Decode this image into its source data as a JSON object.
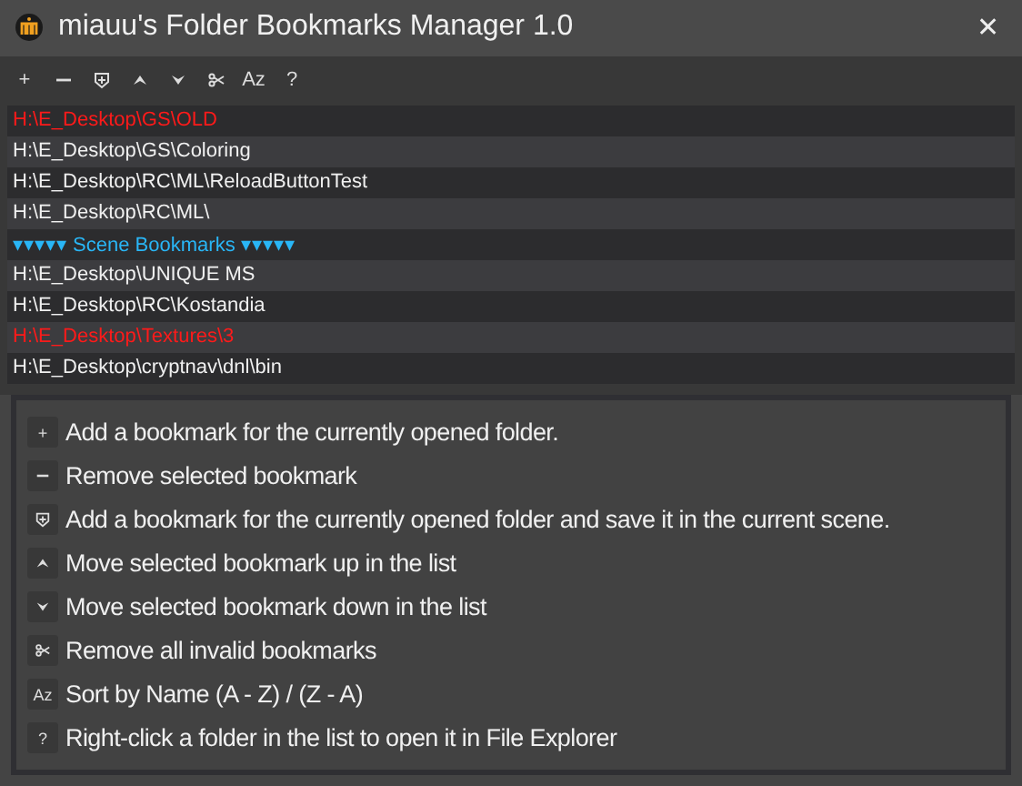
{
  "window": {
    "title": "miauu's Folder Bookmarks Manager 1.0",
    "close": "✕"
  },
  "toolbar": [
    {
      "kind": "glyph",
      "glyph": "+"
    },
    {
      "kind": "icon"
    },
    {
      "kind": "icon"
    },
    {
      "kind": "icon"
    },
    {
      "kind": "icon"
    },
    {
      "kind": "icon"
    },
    {
      "kind": "glyph",
      "glyph": "Az"
    },
    {
      "kind": "glyph",
      "glyph": "?"
    }
  ],
  "bookmarks": [
    {
      "kind": "path",
      "text": "H:\\E_Desktop\\GS\\OLD",
      "invalid": true
    },
    {
      "kind": "path",
      "text": "H:\\E_Desktop\\GS\\Coloring",
      "invalid": false
    },
    {
      "kind": "path",
      "text": "H:\\E_Desktop\\RC\\ML\\ReloadButtonTest",
      "invalid": false
    },
    {
      "kind": "path",
      "text": "H:\\E_Desktop\\RC\\ML\\",
      "invalid": false
    },
    {
      "kind": "separator",
      "text": "▾▾▾▾▾ Scene Bookmarks ▾▾▾▾▾"
    },
    {
      "kind": "path",
      "text": "H:\\E_Desktop\\UNIQUE MS",
      "invalid": false
    },
    {
      "kind": "path",
      "text": "H:\\E_Desktop\\RC\\Kostandia",
      "invalid": false
    },
    {
      "kind": "path",
      "text": "H:\\E_Desktop\\Textures\\3",
      "invalid": true
    },
    {
      "kind": "path",
      "text": "H:\\E_Desktop\\cryptnav\\dnl\\bin",
      "invalid": false
    }
  ],
  "help": [
    {
      "kind": "glyph",
      "glyph": "+",
      "text": "Add a bookmark for the currently opened folder."
    },
    {
      "kind": "icon",
      "text": "Remove selected bookmark"
    },
    {
      "kind": "icon",
      "text": "Add a bookmark for the currently opened folder and save it in the current scene."
    },
    {
      "kind": "icon",
      "text": "Move selected bookmark up in the list"
    },
    {
      "kind": "icon",
      "text": "Move selected bookmark down in the list"
    },
    {
      "kind": "icon",
      "text": "Remove all invalid bookmarks"
    },
    {
      "kind": "glyph",
      "glyph": "Az",
      "text": "Sort by Name (A - Z) / (Z - A)"
    },
    {
      "kind": "glyph",
      "glyph": "?",
      "text": "Right-click a folder in the list to open it in File Explorer"
    }
  ]
}
